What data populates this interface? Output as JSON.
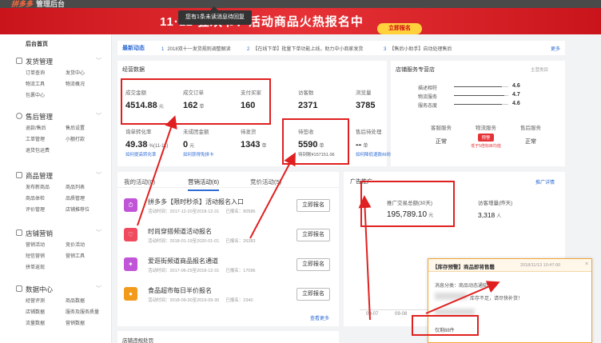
{
  "topbar": {
    "logo": "拼多多",
    "title": "管理后台"
  },
  "notice": "您有1条未读消息待回复",
  "banner": {
    "text": "11·11 狂欢节！活动商品火热报名中",
    "button": "立即报名"
  },
  "sidebar": {
    "home": "后台首页",
    "sections": [
      {
        "title": "发货管理",
        "items": [
          "订单查询",
          "发货中心",
          "物流工具",
          "物流概况",
          "包裹中心"
        ]
      },
      {
        "title": "售后管理",
        "items": [
          "退款/售后",
          "售后设置",
          "工单管理",
          "小额打款",
          "退货包运费"
        ]
      },
      {
        "title": "商品管理",
        "items": [
          "发布新商品",
          "商品列表",
          "商品体检",
          "品质管理",
          "评价管理",
          "店铺推荐位"
        ]
      },
      {
        "title": "店铺营销",
        "items": [
          "营销活动",
          "竞价活动",
          "短信营销",
          "营销工具",
          "拼单返现"
        ]
      },
      {
        "title": "数据中心",
        "items": [
          "经营评测",
          "商品数据",
          "店铺数据",
          "服务及服务质量",
          "流量数据",
          "营销数据"
        ]
      }
    ]
  },
  "dynamics": {
    "label": "最新动态",
    "items": [
      {
        "n": "1",
        "text": "2018双十一发货规则调整解读"
      },
      {
        "n": "2",
        "text": "【在线下单】批量下单功能上线，助力中小商家发货"
      },
      {
        "n": "3",
        "text": "【售后小助手】自动处理售后"
      }
    ],
    "more": "更多"
  },
  "ops": {
    "title": "经营数据",
    "metrics": [
      {
        "label": "成交金额",
        "value": "4514.88",
        "unit": "元"
      },
      {
        "label": "成交订单",
        "value": "162",
        "unit": "单"
      },
      {
        "label": "支付买家",
        "value": "160",
        "unit": ""
      },
      {
        "label": "访客数",
        "value": "2371",
        "unit": ""
      },
      {
        "label": "浏览量",
        "value": "3785",
        "unit": ""
      },
      {
        "label": "询单转化率",
        "value": "49.38",
        "unit": "%(11-11)",
        "note": "如何提高转化率"
      },
      {
        "label": "未成团金额",
        "value": "0",
        "unit": "元",
        "note": "如何获得免拼卡"
      },
      {
        "label": "待发货",
        "value": "1343",
        "unit": "单",
        "note": ""
      },
      {
        "label": "待签收",
        "value": "5590",
        "unit": "单",
        "note": "待到账¥157151.06"
      },
      {
        "label": "售后待处理",
        "value": "--",
        "unit": "单",
        "note": "如何降低退款纠纷"
      }
    ]
  },
  "shop": {
    "title": "店铺服务专营店",
    "link": "主营类目",
    "scores": [
      {
        "label": "描述相符",
        "value": "4.6"
      },
      {
        "label": "物流服务",
        "value": "4.7"
      },
      {
        "label": "服务态度",
        "value": "4.6"
      }
    ],
    "services": [
      {
        "label": "客服服务",
        "status": "正常"
      },
      {
        "label": "物流服务",
        "status": "预警",
        "warn": "低于5倍标目均值"
      },
      {
        "label": "售后服务",
        "status": "正常"
      }
    ]
  },
  "activity": {
    "tabs": [
      "我的活动(0)",
      "营销活动(6)",
      "竞价活动(5)"
    ],
    "rows": [
      {
        "title": "拼多多【限时秒杀】活动报名入口",
        "time": "活动时间：2017-12-20至2018-12-31",
        "count": "已报名：80586",
        "button": "立即报名",
        "color": "#c055d8"
      },
      {
        "title": "时尚穿搭频道活动报名",
        "time": "活动时间：2018-01-19至2020-01-01",
        "count": "已报名：26383",
        "button": "立即报名",
        "color": "#ef4a5d"
      },
      {
        "title": "爱逛街频道商品报名通道",
        "time": "活动时间：2017-06-29至2018-12-31",
        "count": "已报名：17096",
        "button": "立即报名",
        "color": "#c055d8"
      },
      {
        "title": "食品超市每日半价报名",
        "time": "活动时间：2018-09-30至2019-09-30",
        "count": "已报名：2340",
        "button": "立即报名",
        "color": "#f29a1a"
      }
    ],
    "more": "查看更多"
  },
  "ad": {
    "title": "广告推广",
    "link": "推广详情",
    "m1": {
      "label": "推广交易总额(30天)",
      "value": "195,789.10",
      "unit": "元"
    },
    "m2": {
      "label": "访客增量(昨天)",
      "value": "3,318",
      "unit": "人"
    },
    "ticks": [
      "09-07",
      "09-08"
    ]
  },
  "bottom": {
    "title": "店铺违规处罚"
  },
  "popup": {
    "title": "【库存预警】商品即将售罄",
    "time": "2018/11/13 10:47:00",
    "close": "×",
    "line1": "消息分类：商品动态通知",
    "line2": "库存不足，请尽快补货！",
    "line3": "仅剩88件"
  }
}
